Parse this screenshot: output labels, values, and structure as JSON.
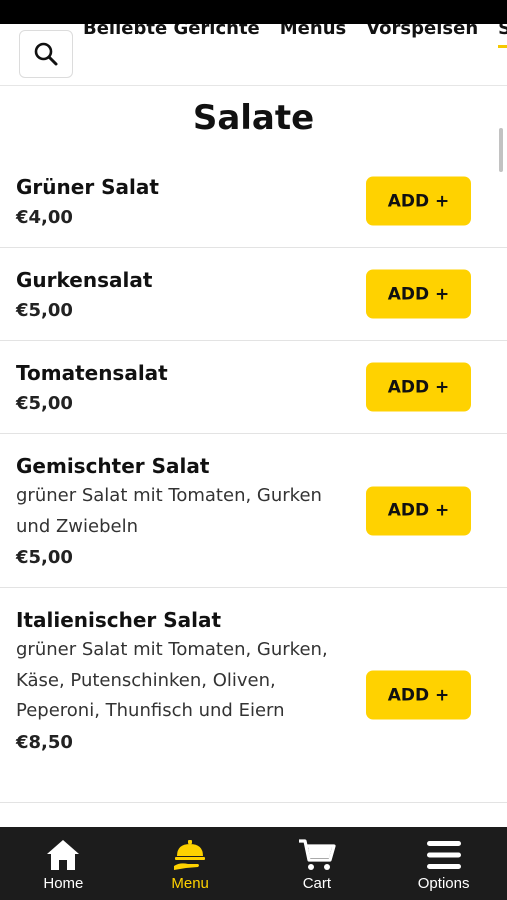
{
  "categories": [
    {
      "label": "Beliebte Gerichte",
      "active": false
    },
    {
      "label": "Menus",
      "active": false
    },
    {
      "label": "Vorspeisen",
      "active": false
    },
    {
      "label": "Sa",
      "active": true
    }
  ],
  "section": {
    "title": "Salate"
  },
  "items": [
    {
      "name": "Grüner Salat",
      "description": "",
      "price": "€4,00",
      "button": "ADD +"
    },
    {
      "name": "Gurkensalat",
      "description": "",
      "price": "€5,00",
      "button": "ADD +"
    },
    {
      "name": "Tomatensalat",
      "description": "",
      "price": "€5,00",
      "button": "ADD +"
    },
    {
      "name": "Gemischter Salat",
      "description": "grüner Salat mit Tomaten, Gurken und Zwiebeln",
      "price": "€5,00",
      "button": "ADD +"
    },
    {
      "name": "Italienischer Salat",
      "description": "grüner Salat mit Tomaten, Gurken, Käse, Putenschinken, Oliven, Peperoni, Thunfisch und Eiern",
      "price": "€8,50",
      "button": "ADD +"
    }
  ],
  "bottom_nav": [
    {
      "label": "Home",
      "icon": "home-icon",
      "active": false
    },
    {
      "label": "Menu",
      "icon": "serving-bell-icon",
      "active": true
    },
    {
      "label": "Cart",
      "icon": "cart-icon",
      "active": false
    },
    {
      "label": "Options",
      "icon": "menu-bars-icon",
      "active": false
    }
  ],
  "colors": {
    "accent": "#ffd200",
    "nav_bg": "#1c1c1c",
    "text": "#111111"
  }
}
